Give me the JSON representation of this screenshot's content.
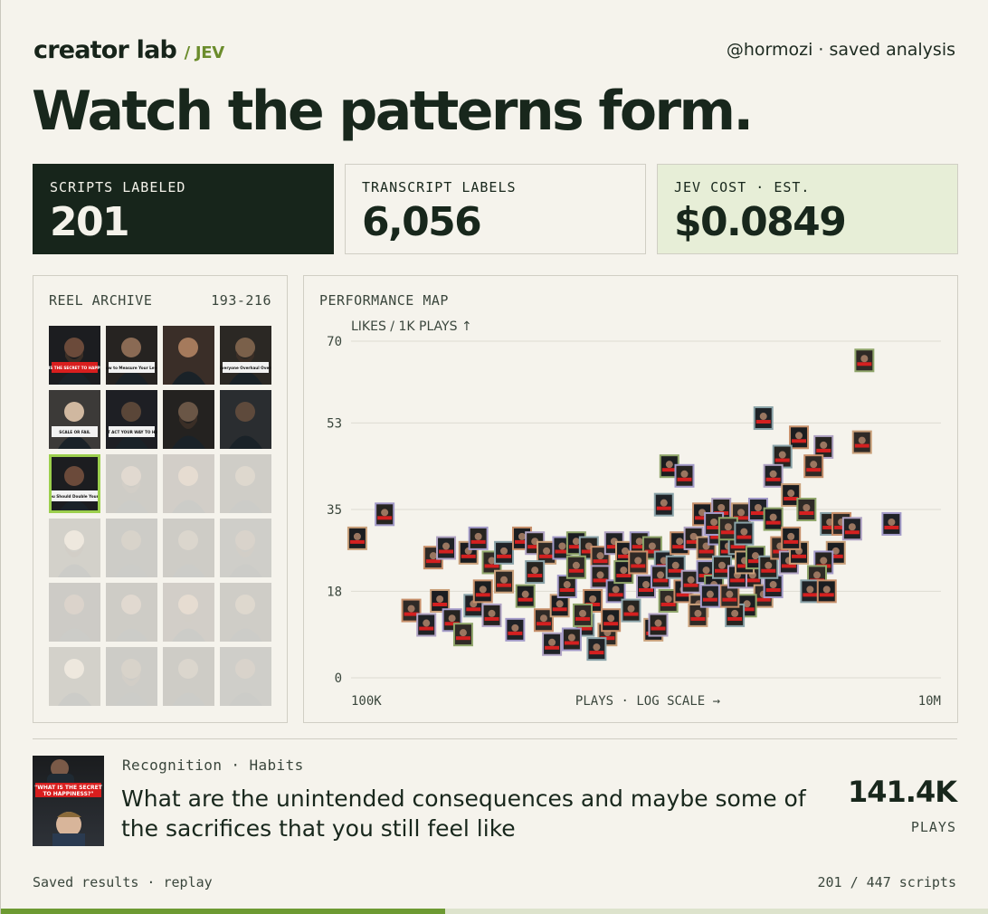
{
  "header": {
    "brand": "creator lab",
    "brand_sub": "/ JEV",
    "handle": "@hormozi · saved analysis",
    "headline": "Watch the patterns form."
  },
  "stats": [
    {
      "label": "SCRIPTS LABELED",
      "value": "201"
    },
    {
      "label": "TRANSCRIPT LABELS",
      "value": "6,056"
    },
    {
      "label": "JEV COST · EST.",
      "value": "$0.0849"
    }
  ],
  "archive": {
    "title": "REEL ARCHIVE",
    "range": "193-216",
    "thumbs": [
      {
        "text": "\"WHAT IS THE SECRET TO HAPPINESS?\"",
        "faded": false,
        "selected": false
      },
      {
        "text": "How to Measure Your Level",
        "faded": false,
        "selected": false
      },
      {
        "text": "",
        "faded": false,
        "selected": false
      },
      {
        "text": "Fire Everyone Overhaul Overnight",
        "faded": false,
        "selected": false
      },
      {
        "text": "SCALE OR FAIL",
        "faded": false,
        "selected": false
      },
      {
        "text": "YOU CAN'T ACT YOUR WAY TO HAPPINESS",
        "faded": false,
        "selected": false
      },
      {
        "text": "",
        "faded": false,
        "selected": false
      },
      {
        "text": "",
        "faded": false,
        "selected": false
      },
      {
        "text": "Why You Should Double Your Prices",
        "faded": false,
        "selected": true
      },
      {
        "text": "",
        "faded": true,
        "selected": false
      },
      {
        "text": "",
        "faded": true,
        "selected": false
      },
      {
        "text": "",
        "faded": true,
        "selected": false
      },
      {
        "text": "",
        "faded": true,
        "selected": false
      },
      {
        "text": "",
        "faded": true,
        "selected": false
      },
      {
        "text": "",
        "faded": true,
        "selected": false
      },
      {
        "text": "",
        "faded": true,
        "selected": false
      },
      {
        "text": "",
        "faded": true,
        "selected": false
      },
      {
        "text": "",
        "faded": true,
        "selected": false
      },
      {
        "text": "",
        "faded": true,
        "selected": false
      },
      {
        "text": "",
        "faded": true,
        "selected": false
      },
      {
        "text": "",
        "faded": true,
        "selected": false
      },
      {
        "text": "",
        "faded": true,
        "selected": false
      },
      {
        "text": "",
        "faded": true,
        "selected": false
      },
      {
        "text": "",
        "faded": true,
        "selected": false
      }
    ]
  },
  "map": {
    "title": "PERFORMANCE MAP"
  },
  "chart_data": {
    "type": "scatter",
    "ylabel": "LIKES / 1K PLAYS ↑",
    "xlabel": "PLAYS · LOG SCALE →",
    "x_scale": "log",
    "xlim": [
      100000,
      10000000
    ],
    "ylim": [
      0,
      70
    ],
    "y_ticks": [
      0,
      18,
      35,
      53,
      70
    ],
    "x_tick_labels": [
      "100K",
      "10M"
    ],
    "grid": true,
    "points": [
      {
        "x": 105000,
        "y": 29
      },
      {
        "x": 130000,
        "y": 34
      },
      {
        "x": 5500000,
        "y": 66
      },
      {
        "x": 2500000,
        "y": 54
      },
      {
        "x": 3300000,
        "y": 50
      },
      {
        "x": 4000000,
        "y": 48
      },
      {
        "x": 5400000,
        "y": 49
      },
      {
        "x": 6800000,
        "y": 32
      },
      {
        "x": 1200000,
        "y": 44
      },
      {
        "x": 2900000,
        "y": 46
      },
      {
        "x": 3700000,
        "y": 44
      },
      {
        "x": 2700000,
        "y": 42
      },
      {
        "x": 3100000,
        "y": 38
      },
      {
        "x": 1350000,
        "y": 42
      },
      {
        "x": 3500000,
        "y": 35
      },
      {
        "x": 1150000,
        "y": 36
      },
      {
        "x": 1550000,
        "y": 34
      },
      {
        "x": 1800000,
        "y": 35
      },
      {
        "x": 2100000,
        "y": 34
      },
      {
        "x": 2400000,
        "y": 35
      },
      {
        "x": 2700000,
        "y": 33
      },
      {
        "x": 4200000,
        "y": 32
      },
      {
        "x": 4600000,
        "y": 32
      },
      {
        "x": 5000000,
        "y": 31
      },
      {
        "x": 4400000,
        "y": 26
      },
      {
        "x": 4000000,
        "y": 24
      },
      {
        "x": 3800000,
        "y": 21
      },
      {
        "x": 3600000,
        "y": 18
      },
      {
        "x": 4100000,
        "y": 18
      },
      {
        "x": 2300000,
        "y": 21
      },
      {
        "x": 2500000,
        "y": 17
      },
      {
        "x": 2700000,
        "y": 19
      },
      {
        "x": 2200000,
        "y": 15
      },
      {
        "x": 2000000,
        "y": 13
      },
      {
        "x": 190000,
        "y": 25
      },
      {
        "x": 210000,
        "y": 27
      },
      {
        "x": 250000,
        "y": 26
      },
      {
        "x": 270000,
        "y": 29
      },
      {
        "x": 300000,
        "y": 24
      },
      {
        "x": 330000,
        "y": 26
      },
      {
        "x": 380000,
        "y": 29
      },
      {
        "x": 420000,
        "y": 28
      },
      {
        "x": 460000,
        "y": 26
      },
      {
        "x": 520000,
        "y": 27
      },
      {
        "x": 580000,
        "y": 28
      },
      {
        "x": 640000,
        "y": 27
      },
      {
        "x": 700000,
        "y": 25
      },
      {
        "x": 780000,
        "y": 28
      },
      {
        "x": 850000,
        "y": 26
      },
      {
        "x": 950000,
        "y": 28
      },
      {
        "x": 1050000,
        "y": 27
      },
      {
        "x": 1150000,
        "y": 24
      },
      {
        "x": 1300000,
        "y": 28
      },
      {
        "x": 1450000,
        "y": 29
      },
      {
        "x": 1600000,
        "y": 27
      },
      {
        "x": 1750000,
        "y": 30
      },
      {
        "x": 1900000,
        "y": 27
      },
      {
        "x": 2050000,
        "y": 28
      },
      {
        "x": 160000,
        "y": 14
      },
      {
        "x": 180000,
        "y": 11
      },
      {
        "x": 200000,
        "y": 16
      },
      {
        "x": 220000,
        "y": 12
      },
      {
        "x": 240000,
        "y": 9
      },
      {
        "x": 260000,
        "y": 15
      },
      {
        "x": 280000,
        "y": 18
      },
      {
        "x": 300000,
        "y": 13
      },
      {
        "x": 330000,
        "y": 20
      },
      {
        "x": 360000,
        "y": 10
      },
      {
        "x": 390000,
        "y": 17
      },
      {
        "x": 420000,
        "y": 22
      },
      {
        "x": 450000,
        "y": 12
      },
      {
        "x": 480000,
        "y": 7
      },
      {
        "x": 510000,
        "y": 15
      },
      {
        "x": 540000,
        "y": 19
      },
      {
        "x": 580000,
        "y": 23
      },
      {
        "x": 620000,
        "y": 11
      },
      {
        "x": 660000,
        "y": 16
      },
      {
        "x": 700000,
        "y": 21
      },
      {
        "x": 740000,
        "y": 9
      },
      {
        "x": 790000,
        "y": 18
      },
      {
        "x": 840000,
        "y": 22
      },
      {
        "x": 890000,
        "y": 14
      },
      {
        "x": 940000,
        "y": 24
      },
      {
        "x": 1000000,
        "y": 19
      },
      {
        "x": 1060000,
        "y": 10
      },
      {
        "x": 1120000,
        "y": 21
      },
      {
        "x": 1190000,
        "y": 16
      },
      {
        "x": 1260000,
        "y": 23
      },
      {
        "x": 1340000,
        "y": 18
      },
      {
        "x": 1420000,
        "y": 20
      },
      {
        "x": 1510000,
        "y": 15
      },
      {
        "x": 1600000,
        "y": 22
      },
      {
        "x": 1700000,
        "y": 19
      },
      {
        "x": 1810000,
        "y": 23
      },
      {
        "x": 1920000,
        "y": 17
      },
      {
        "x": 2040000,
        "y": 21
      },
      {
        "x": 2160000,
        "y": 24
      },
      {
        "x": 560000,
        "y": 8
      },
      {
        "x": 610000,
        "y": 13
      },
      {
        "x": 680000,
        "y": 6
      },
      {
        "x": 760000,
        "y": 12
      },
      {
        "x": 1100000,
        "y": 11
      },
      {
        "x": 1500000,
        "y": 13
      },
      {
        "x": 1650000,
        "y": 17
      },
      {
        "x": 2350000,
        "y": 25
      },
      {
        "x": 2600000,
        "y": 23
      },
      {
        "x": 2850000,
        "y": 27
      },
      {
        "x": 3050000,
        "y": 24
      },
      {
        "x": 3300000,
        "y": 26
      },
      {
        "x": 1700000,
        "y": 32
      },
      {
        "x": 1900000,
        "y": 31
      },
      {
        "x": 2150000,
        "y": 30
      },
      {
        "x": 3100000,
        "y": 29
      }
    ]
  },
  "detail": {
    "tags": "Recognition · Habits",
    "quote": "What are the unintended consequences and maybe some of the sacrifices that you still feel like",
    "plays": "141.4K",
    "plays_unit": "PLAYS",
    "thumb_text": "\"WHAT IS THE SECRET TO HAPPINESS?\""
  },
  "footer": {
    "left": "Saved results · replay",
    "right": "201 / 447 scripts",
    "progress": 0.45
  },
  "colors": {
    "bg": "#f5f3ec",
    "dark": "#17251b",
    "accent": "#6d9a32",
    "highlight": "#9ccf4d",
    "green_panel": "#e7eed7"
  }
}
